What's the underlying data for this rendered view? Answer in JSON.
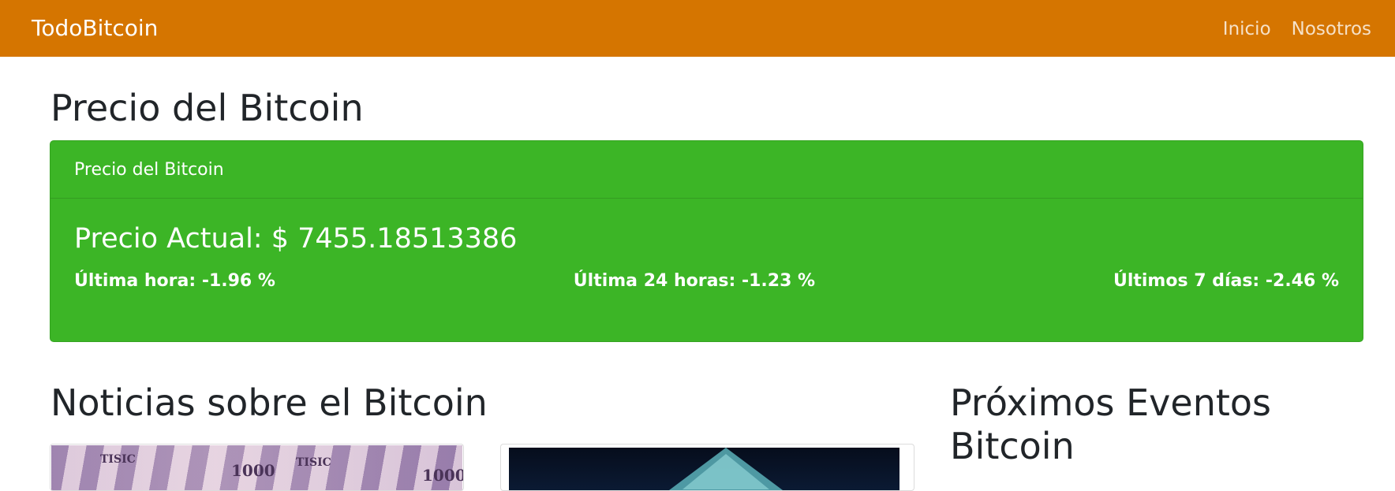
{
  "navbar": {
    "brand": "TodoBitcoin",
    "links": [
      "Inicio",
      "Nosotros"
    ],
    "background_color": "#d57500"
  },
  "page": {
    "title": "Precio del Bitcoin"
  },
  "price_card": {
    "header": "Precio del Bitcoin",
    "current_price": "Precio Actual: $ 7455.18513386",
    "stats": [
      "Última hora: -1.96 %",
      "Última 24 horas: -1.23 %",
      "Últimos 7 días: -2.46 %"
    ],
    "background_color": "#3cb526"
  },
  "news": {
    "title": "Noticias sobre el Bitcoin",
    "images": [
      {
        "icon": "banknotes-image",
        "labels": [
          "TISIC",
          "1000",
          "TISIC",
          "1000"
        ]
      },
      {
        "icon": "crypto-image"
      }
    ]
  },
  "events": {
    "title": "Próximos Eventos Bitcoin"
  }
}
